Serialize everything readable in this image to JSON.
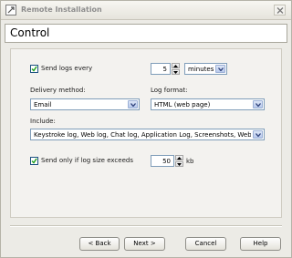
{
  "window": {
    "title": "Remote Installation"
  },
  "header": {
    "title": "Control"
  },
  "send_logs": {
    "checked": true,
    "label": "Send logs every",
    "interval_value": "5",
    "interval_unit": "minutes"
  },
  "delivery": {
    "label": "Delivery method:",
    "value": "Email"
  },
  "log_format": {
    "label": "Log format:",
    "value": "HTML (web page)"
  },
  "include": {
    "label": "Include:",
    "value": "Keystroke log, Web log, Chat log, Application Log, Screenshots, Web..."
  },
  "size_limit": {
    "checked": true,
    "label": "Send only if log size exceeds",
    "value": "50",
    "unit": "kb"
  },
  "buttons": {
    "back": "< Back",
    "next": "Next >",
    "cancel": "Cancel",
    "help": "Help"
  }
}
